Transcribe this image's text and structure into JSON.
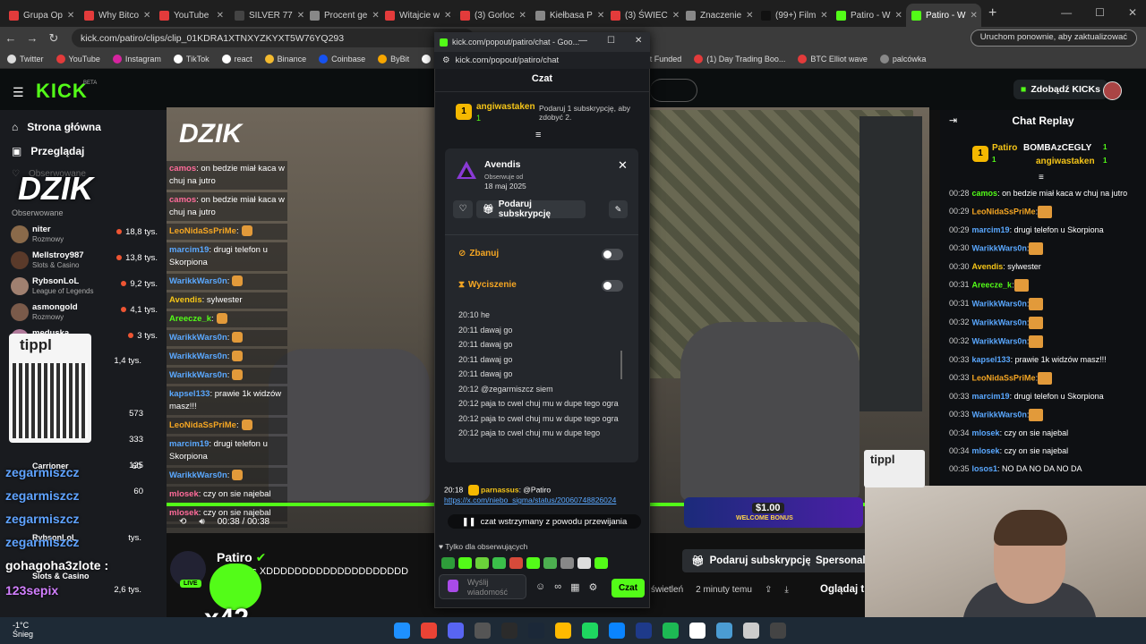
{
  "browser": {
    "tabs": [
      {
        "label": "Grupa Op",
        "color": "#e33b3b"
      },
      {
        "label": "Why Bitco",
        "color": "#e33b3b"
      },
      {
        "label": "YouTube",
        "color": "#e33b3b"
      },
      {
        "label": "SILVER 77",
        "color": "#444444"
      },
      {
        "label": "Procent ge",
        "color": "#888888"
      },
      {
        "label": "Witajcie w",
        "color": "#e33b3b"
      },
      {
        "label": "(3) Gorloc",
        "color": "#e33b3b"
      },
      {
        "label": "Kiełbasa P",
        "color": "#888888"
      },
      {
        "label": "(3) ŚWIEC",
        "color": "#e33b3b"
      },
      {
        "label": "Znaczenie",
        "color": "#888888"
      },
      {
        "label": "(99+) Film",
        "color": "#111111"
      },
      {
        "label": "Patiro - W",
        "color": "#53fc18"
      },
      {
        "label": "Patiro - W",
        "color": "#53fc18",
        "active": true
      }
    ],
    "url": "kick.com/patiro/clips/clip_01KDRA1XTNXYZKYXT5W76YQ293",
    "update_button": "Uruchom ponownie, aby zaktualizować",
    "bookmarks": [
      {
        "label": "Twitter",
        "color": "#dddddd"
      },
      {
        "label": "YouTube",
        "color": "#e33b3b"
      },
      {
        "label": "Instagram",
        "color": "#d6249f"
      },
      {
        "label": "TikTok",
        "color": "#ffffff"
      },
      {
        "label": "react",
        "color": "#ffffff"
      },
      {
        "label": "Binance",
        "color": "#f3ba2f"
      },
      {
        "label": "Coinbase",
        "color": "#1652f0"
      },
      {
        "label": "ByBit",
        "color": "#f7a600"
      },
      {
        "label": "script.txt",
        "color": "#ffffff"
      },
      {
        "label": "FinancialJuice",
        "color": "#ff8800"
      },
      {
        "label": "Polymarket",
        "color": "#2d6cf5"
      },
      {
        "label": "Bright Funded",
        "color": "#3ccf91"
      },
      {
        "label": "(1) Day Trading Boo...",
        "color": "#e33b3b"
      },
      {
        "label": "BTC Elliot wave",
        "color": "#e33b3b"
      },
      {
        "label": "palcówka",
        "color": "#888888"
      }
    ]
  },
  "kick": {
    "logo": "KICK",
    "beta": "BETA",
    "get_kicks": "Zdobądź KICKs",
    "nav": {
      "home": "Strona główna",
      "browse": "Przeglądaj",
      "followed": "Obserwowane",
      "followed2": "Obserwowane"
    },
    "channels": [
      {
        "name": "niter",
        "category": "Rozmowy",
        "viewers": "18,8 tys.",
        "color": "#8a6a4a"
      },
      {
        "name": "Mellstroy987",
        "category": "Slots & Casino",
        "viewers": "13,8 tys.",
        "color": "#5a3a2a"
      },
      {
        "name": "RybsonLoL",
        "category": "League of Legends",
        "viewers": "9,2 tys.",
        "color": "#a08070"
      },
      {
        "name": "asmongold",
        "category": "Rozmowy",
        "viewers": "4,1 tys.",
        "color": "#7a5a4a"
      },
      {
        "name": "meduska",
        "category": "",
        "viewers": "3 tys.",
        "color": "#b07a9a"
      }
    ],
    "sidebar_counts": [
      "1,4 tys.",
      "573",
      "333",
      "125",
      "60"
    ],
    "sidebar_extra": [
      {
        "name": "Carrioner",
        "viewers": "60"
      },
      {
        "name": "RybsonLoL",
        "viewers": "tys."
      },
      {
        "name": "Slots & Casino",
        "viewers": "2,6 tys."
      }
    ],
    "overlay_left": [
      "zegarmiszcz",
      "zegarmiszcz",
      "zegarmiszcz",
      "zegarmiszcz",
      "gohagoha3zlote :",
      "123sepix"
    ],
    "tippl": "tippl"
  },
  "video": {
    "brand": "DZIK",
    "time": "00:38 / 00:38",
    "overlay_chat": [
      {
        "user": "camos",
        "color": "#ff6b9a",
        "text": ": on bedzie miał kaca w chuj na jutro"
      },
      {
        "user": "camos",
        "color": "#ff6b9a",
        "text": ": on bedzie miał kaca w chuj na jutro"
      },
      {
        "user": "LeoNidaSsPriMe",
        "color": "#f5a623",
        "text": ":"
      },
      {
        "user": "marcim19",
        "color": "#5aa8ff",
        "text": ": drugi telefon u Skorpiona"
      },
      {
        "user": "WarikkWars0n",
        "color": "#5aa8ff",
        "text": ":"
      },
      {
        "user": "Avendis",
        "color": "#f5c518",
        "text": ": sylwester"
      },
      {
        "user": "Areecze_k",
        "color": "#53fc18",
        "text": ":"
      },
      {
        "user": "WarikkWars0n",
        "color": "#5aa8ff",
        "text": ":"
      },
      {
        "user": "WarikkWars0n",
        "color": "#5aa8ff",
        "text": ":"
      },
      {
        "user": "WarikkWars0n",
        "color": "#5aa8ff",
        "text": ":"
      },
      {
        "user": "kapsel133",
        "color": "#5aa8ff",
        "text": ": prawie 1k widzów masz!!!"
      },
      {
        "user": "LeoNidaSsPriMe",
        "color": "#f5a623",
        "text": ":"
      },
      {
        "user": "marcim19",
        "color": "#5aa8ff",
        "text": ": drugi telefon u Skorpiona"
      },
      {
        "user": "WarikkWars0n",
        "color": "#5aa8ff",
        "text": ":"
      },
      {
        "user": "mlosek",
        "color": "#ff6b9a",
        "text": ": czy on sie najebal"
      },
      {
        "user": "mlosek",
        "color": "#ff6b9a",
        "text": ": czy on sie najebal"
      },
      {
        "user": "losos1",
        "color": "#ff6b9a",
        "text": ": NO DA NO DA NO DA"
      },
      {
        "user": "mlosek",
        "color": "#ff6b9a",
        "text": ": czy on sie najebal"
      }
    ],
    "bet_ad": {
      "amount": "$1.00",
      "text": "WELCOME BONUS"
    }
  },
  "streamer": {
    "name": "Patiro",
    "live": "LIVE",
    "title": "a Was XDDDDDDDDDDDDDDDDDDDD",
    "counter": "x42",
    "gift_sub": "Podaruj subskrypcję",
    "personalize": "Spersonali",
    "meta": [
      "świetleń",
      "2 minuty temu"
    ],
    "watch": "Oglądaj tr"
  },
  "replay": {
    "title": "Chat Replay",
    "top": [
      {
        "name": "Patiro",
        "color": "#f5c518",
        "badge": "1"
      },
      {
        "name": "BOMBAzCEGLY",
        "color": "#ffffff"
      },
      {
        "name": "angiwastaken",
        "color": "#f5c518"
      }
    ],
    "top_counts": [
      "1",
      "1",
      "1"
    ],
    "messages": [
      {
        "time": "00:28",
        "user": "camos",
        "color": "#53fc18",
        "text": ": on bedzie miał kaca w chuj na jutro"
      },
      {
        "time": "00:29",
        "user": "LeoNidaSsPriMe",
        "color": "#f5a623",
        "text": ":"
      },
      {
        "time": "00:29",
        "user": "marcim19",
        "color": "#5aa8ff",
        "text": ": drugi telefon u Skorpiona"
      },
      {
        "time": "00:30",
        "user": "WarikkWars0n",
        "color": "#5aa8ff",
        "text": ":"
      },
      {
        "time": "00:30",
        "user": "Avendis",
        "color": "#f5c518",
        "text": ": sylwester"
      },
      {
        "time": "00:31",
        "user": "Areecze_k",
        "color": "#53fc18",
        "text": ":"
      },
      {
        "time": "00:31",
        "user": "WarikkWars0n",
        "color": "#5aa8ff",
        "text": ":"
      },
      {
        "time": "00:32",
        "user": "WarikkWars0n",
        "color": "#5aa8ff",
        "text": ":"
      },
      {
        "time": "00:32",
        "user": "WarikkWars0n",
        "color": "#5aa8ff",
        "text": ":"
      },
      {
        "time": "00:33",
        "user": "kapsel133",
        "color": "#5aa8ff",
        "text": ": prawie 1k widzów masz!!!"
      },
      {
        "time": "00:33",
        "user": "LeoNidaSsPriMe",
        "color": "#f5a623",
        "text": ":"
      },
      {
        "time": "00:33",
        "user": "marcim19",
        "color": "#5aa8ff",
        "text": ": drugi telefon u Skorpiona"
      },
      {
        "time": "00:33",
        "user": "WarikkWars0n",
        "color": "#5aa8ff",
        "text": ":"
      },
      {
        "time": "00:34",
        "user": "mlosek",
        "color": "#5aa8ff",
        "text": ": czy on sie najebal"
      },
      {
        "time": "00:34",
        "user": "mlosek",
        "color": "#5aa8ff",
        "text": ": czy on sie najebal"
      },
      {
        "time": "00:35",
        "user": "losos1",
        "color": "#5aa8ff",
        "text": ": NO DA NO DA NO DA"
      }
    ]
  },
  "popup": {
    "window_title": "kick.com/popout/patiro/chat - Goo...",
    "url": "kick.com/popout/patiro/chat",
    "header": "Czat",
    "top_user": "angiwastaken",
    "top_badge": "1",
    "top_count": "1",
    "gift_hint": "Podaruj 1 subskrypcję, aby zdobyć 2.",
    "card": {
      "name": "Avendis",
      "follows_label": "Obserwuje od",
      "follows_date": "18 maj 2025",
      "gift_button": "Podaruj subskrypcję",
      "ban": "Zbanuj",
      "timeout": "Wyciszenie",
      "log": [
        "20:10 he",
        "20:11 dawaj go",
        "20:11 dawaj go",
        "20:11 dawaj go",
        "20:11 dawaj go",
        "20:12 @zegarmiszcz siem",
        "20:12 paja to cwel chuj mu w dupe tego ogra",
        "20:12 paja to cwel chuj mu w dupe tego ogra",
        "20:12 paja to cwel chuj mu w dupe tego"
      ]
    },
    "pinned": {
      "time": "20:18",
      "user": "parnassus",
      "text": ": @Patiro",
      "link": "https://x.com/niebo_sigma/status/20060748826024"
    },
    "paused": "czat wstrzymany z powodu przewijania",
    "followers_only": "Tylko dla obserwujących",
    "input_placeholder": "Wyślij wiadomość",
    "send_button": "Czat"
  },
  "taskbar": {
    "temp": "-1°C",
    "weather": "Śnieg"
  }
}
